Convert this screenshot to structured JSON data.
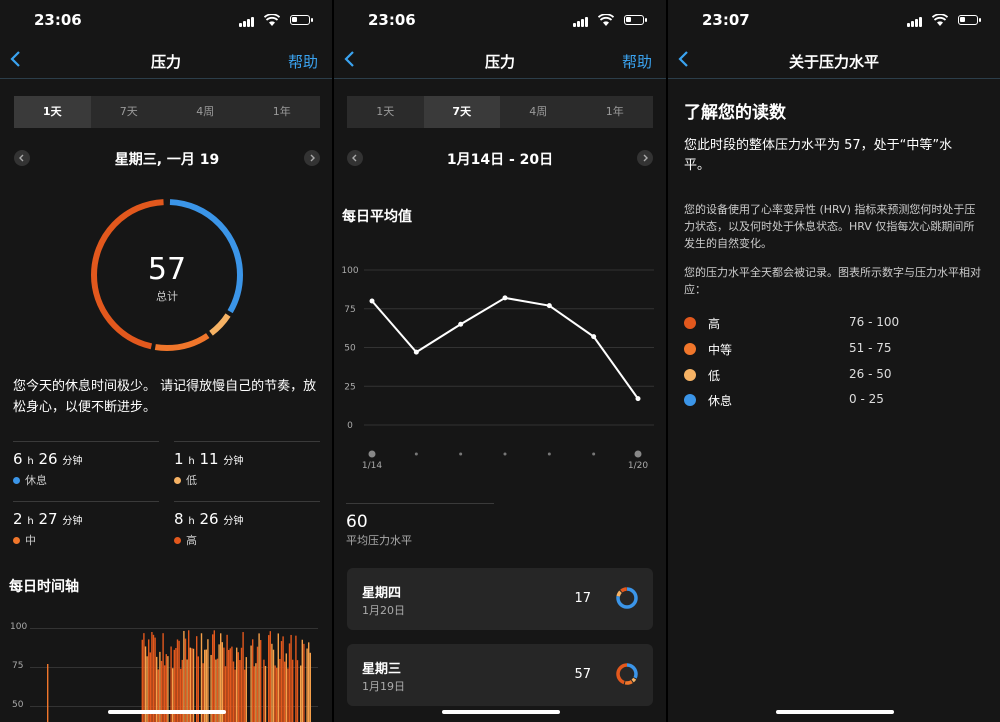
{
  "colors": {
    "high": "#e2581d",
    "medium": "#f0762b",
    "low": "#f6b264",
    "rest": "#3b95e8",
    "accent": "#3aa3f0"
  },
  "screen1": {
    "time": "23:06",
    "title": "压力",
    "help": "帮助",
    "tabs": [
      "1天",
      "7天",
      "4周",
      "1年"
    ],
    "date": "星期三, 一月 19",
    "score": "57",
    "score_label": "总计",
    "message": "您今天的休息时间极少。 请记得放慢自己的节奏，放松身心，以便不断进步。",
    "stats": [
      {
        "h": "6",
        "hu": "h",
        "m": "26",
        "mu": "分钟",
        "label": "休息",
        "color": "#3b95e8"
      },
      {
        "h": "1",
        "hu": "h",
        "m": "11",
        "mu": "分钟",
        "label": "低",
        "color": "#f6b264"
      },
      {
        "h": "2",
        "hu": "h",
        "m": "27",
        "mu": "分钟",
        "label": "中",
        "color": "#f0762b"
      },
      {
        "h": "8",
        "hu": "h",
        "m": "26",
        "mu": "分钟",
        "label": "高",
        "color": "#e2581d"
      }
    ],
    "timeline_title": "每日时间轴",
    "timeline_ticks": [
      "100",
      "75",
      "50"
    ]
  },
  "screen2": {
    "time": "23:06",
    "title": "压力",
    "help": "帮助",
    "tabs": [
      "1天",
      "7天",
      "4周",
      "1年"
    ],
    "date": "1月14日 - 20日",
    "chart_title": "每日平均值",
    "avg_value": "60",
    "avg_label": "平均压力水平",
    "days": [
      {
        "day": "星期四",
        "date": "1月20日",
        "value": "17"
      },
      {
        "day": "星期三",
        "date": "1月19日",
        "value": "57"
      }
    ]
  },
  "chart_data": {
    "type": "line",
    "title": "每日平均值",
    "x": [
      "1/14",
      "1/15",
      "1/16",
      "1/17",
      "1/18",
      "1/19",
      "1/20"
    ],
    "x_tick_labels": [
      "1/14",
      "1/20"
    ],
    "values": [
      80,
      47,
      65,
      82,
      77,
      57,
      17
    ],
    "y_ticks": [
      "100",
      "75",
      "50",
      "25",
      "0"
    ],
    "ylim": [
      0,
      100
    ]
  },
  "screen3": {
    "time": "23:07",
    "title": "关于压力水平",
    "heading": "了解您的读数",
    "p1": "您此时段的整体压力水平为 57，处于“中等”水平。",
    "p2": "您的设备使用了心率变异性 (HRV) 指标来预测您何时处于压力状态，以及何时处于休息状态。HRV 仅指每次心跳期间所发生的自然变化。",
    "p3": "您的压力水平全天都会被记录。图表所示数字与压力水平相对应：",
    "legend": [
      {
        "name": "高",
        "range": "76 - 100",
        "color": "#e2581d"
      },
      {
        "name": "中等",
        "range": "51 - 75",
        "color": "#f0762b"
      },
      {
        "name": "低",
        "range": "26 - 50",
        "color": "#f6b264"
      },
      {
        "name": "休息",
        "range": "0 - 25",
        "color": "#3b95e8"
      }
    ]
  }
}
